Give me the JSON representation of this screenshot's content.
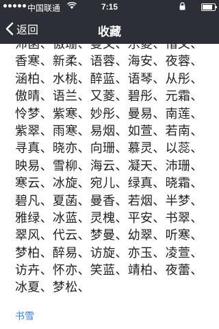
{
  "status_bar": {
    "carrier": "中国联通",
    "time": "7:15",
    "battery_level": 0.85
  },
  "nav": {
    "back_label": "返回",
    "title": "收藏"
  },
  "names": [
    "沛菡、傲珊、曼文、乐菱、惜文、",
    "香寒、新柔、语蓉、海安、夜蓉、",
    "涵柏、水桃、醉蓝、语琴、从彤、",
    "傲晴、语兰、又菱、碧彤、元霜、",
    "怜梦、紫寒、妙彤、曼易、南莲、",
    "紫翠、雨寒、易烟、如萱、若南、",
    "寻真、晓亦、向珊、慕灵、以蕊、",
    "映易、雪柳、海云、凝天、沛珊、",
    "寒云、冰旋、宛儿、绿真、晓霜、",
    "碧凡、夏菡、曼香、若烟、半梦、",
    "雅绿、冰蓝、灵槐、平安、书翠、",
    "翠风、代云、梦曼、幼翠、听寒、",
    "梦柏、醉易、访旋、亦玉、凌萱、",
    "访卉、怀亦、笑蓝、靖柏、夜蕾、",
    "冰夏、梦松、"
  ],
  "link_label": "书雪"
}
